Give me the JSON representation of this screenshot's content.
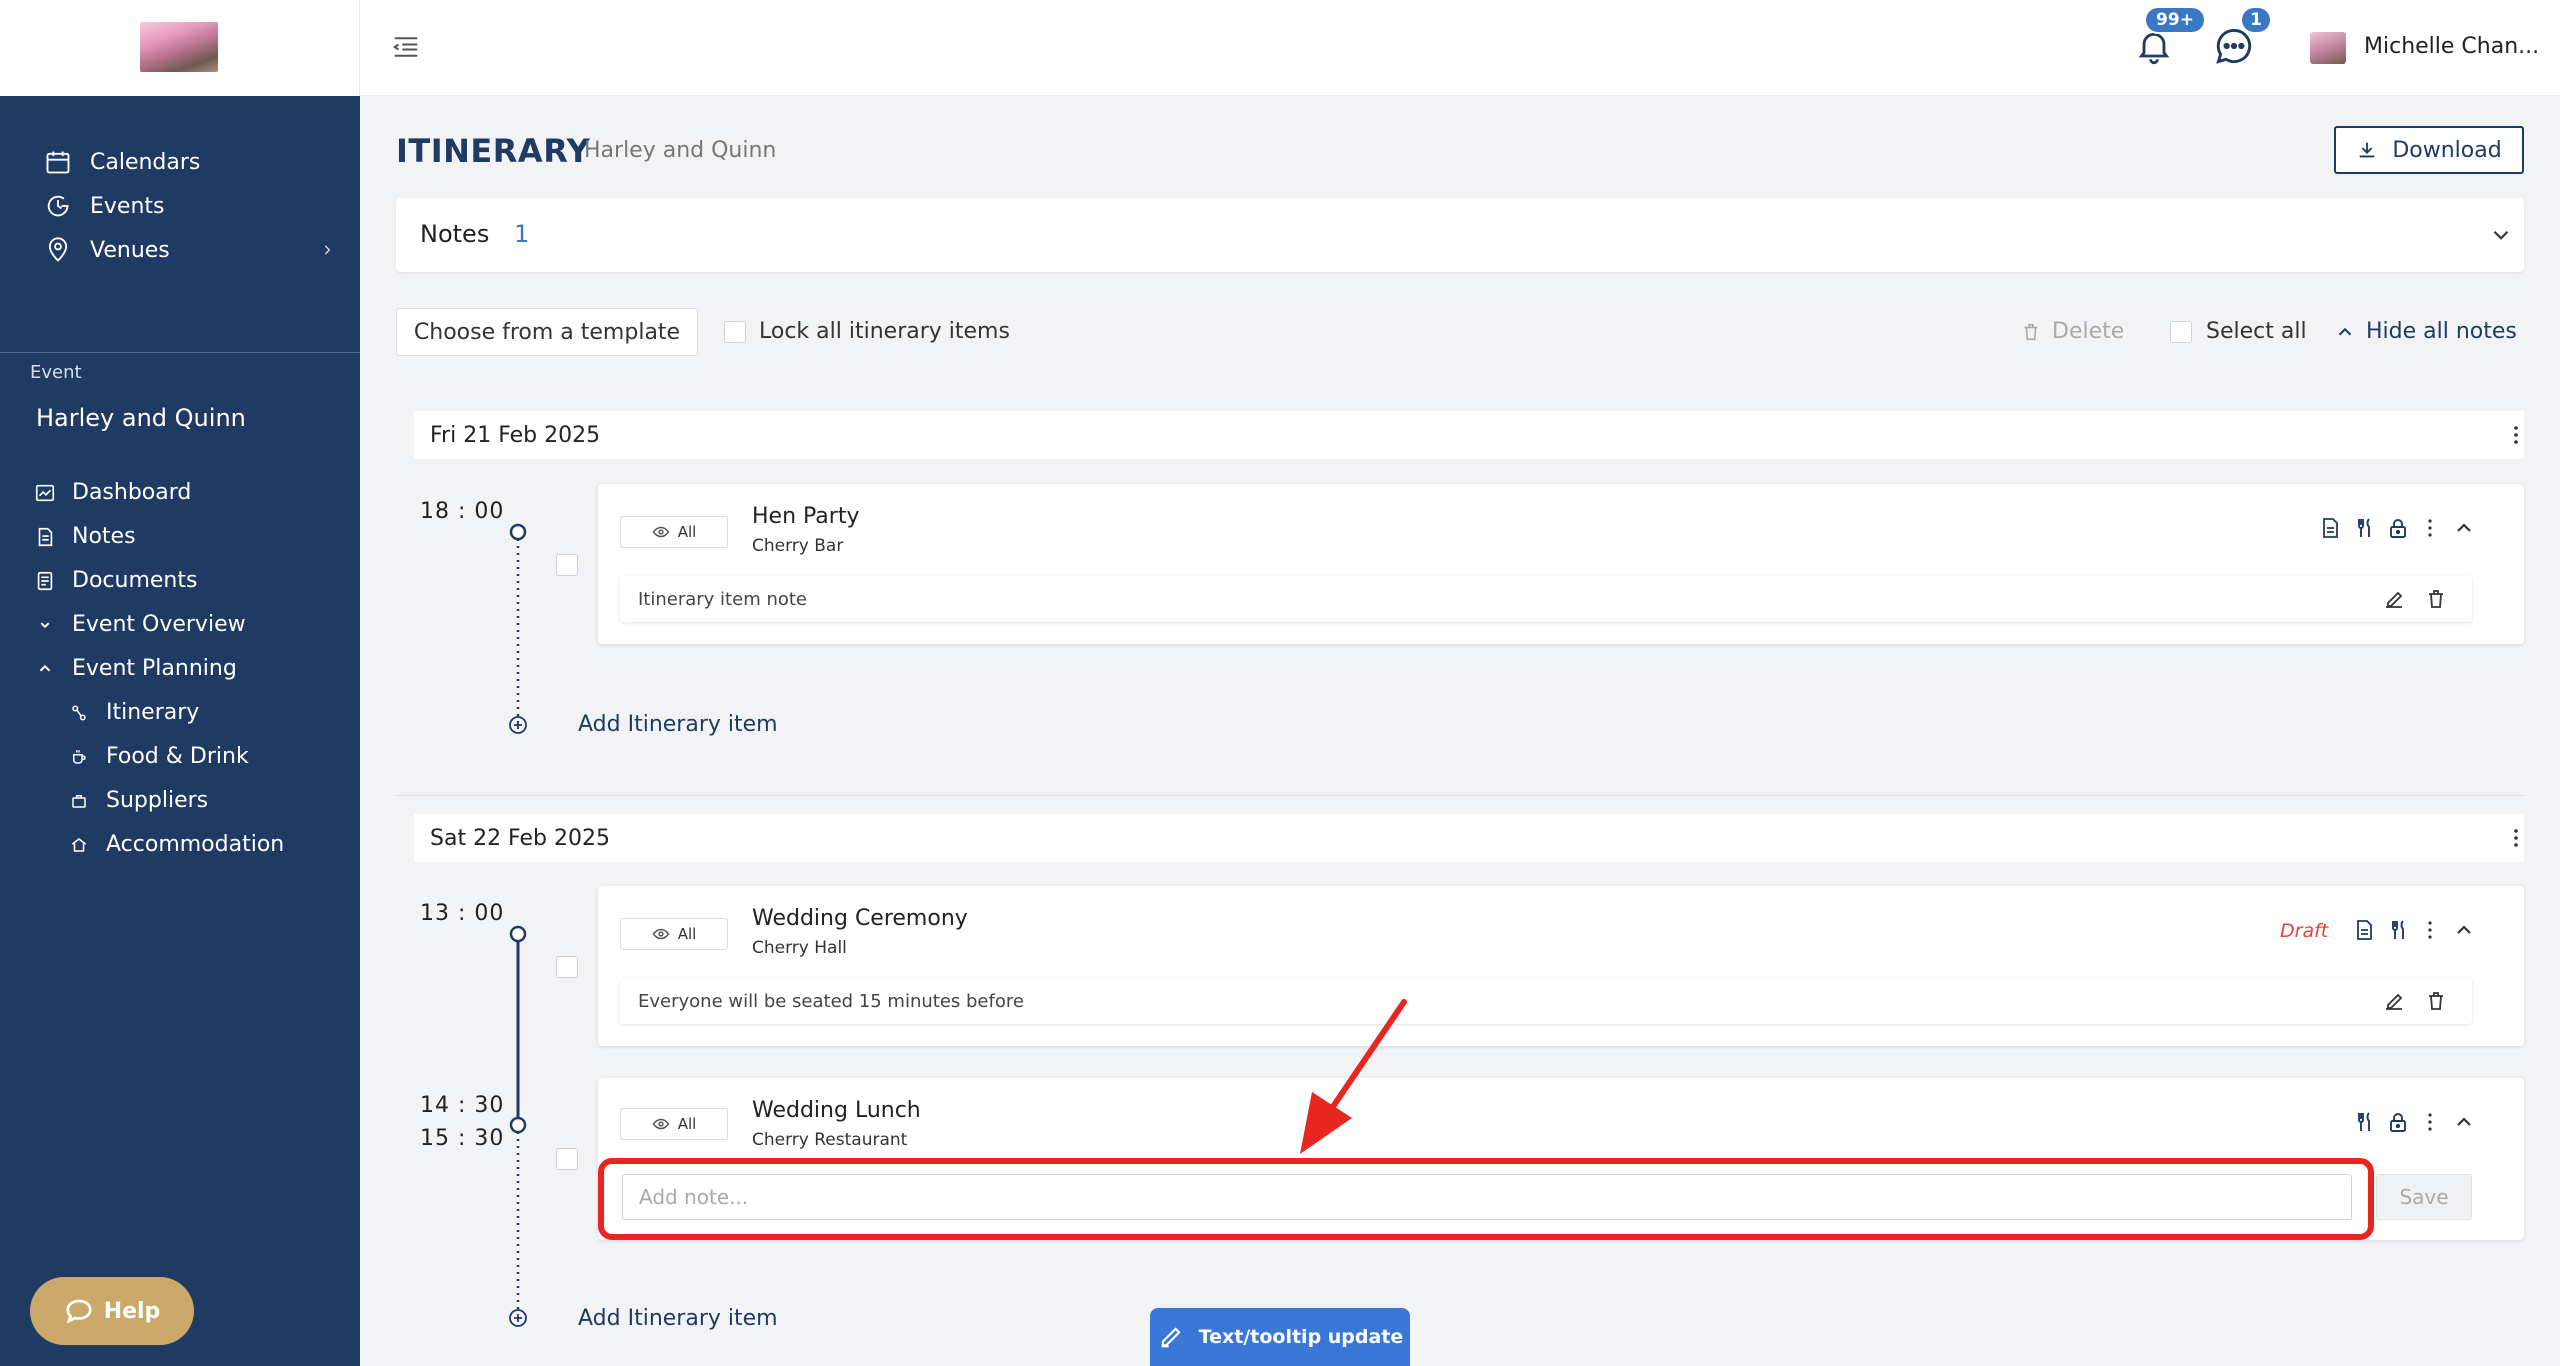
{
  "header": {
    "notifications_count": "99+",
    "messages_count": "1",
    "user_name": "Michelle Chan..."
  },
  "sidebar": {
    "top_items": [
      {
        "label": "Calendars",
        "icon": "calendar-icon"
      },
      {
        "label": "Events",
        "icon": "events-clock-icon"
      },
      {
        "label": "Venues",
        "icon": "location-pin-icon"
      }
    ],
    "event_caption": "Event",
    "event_name": "Harley and Quinn",
    "event_items": [
      {
        "label": "Dashboard",
        "icon": "dashboard-icon"
      },
      {
        "label": "Notes",
        "icon": "notes-icon"
      },
      {
        "label": "Documents",
        "icon": "documents-icon"
      },
      {
        "label": "Event Overview",
        "icon": "chevron-down-icon"
      },
      {
        "label": "Event Planning",
        "icon": "chevron-up-icon"
      }
    ],
    "planning_items": [
      {
        "label": "Itinerary",
        "icon": "itinerary-icon"
      },
      {
        "label": "Food & Drink",
        "icon": "food-drink-icon"
      },
      {
        "label": "Suppliers",
        "icon": "suppliers-icon"
      },
      {
        "label": "Accommodation",
        "icon": "accommodation-icon"
      }
    ],
    "help_label": "Help"
  },
  "page": {
    "title": "ITINERARY",
    "subtitle": "Harley and Quinn",
    "download_label": "Download"
  },
  "notes_panel": {
    "label": "Notes",
    "count": "1"
  },
  "toolbar": {
    "template_label": "Choose from a template",
    "lock_label": "Lock all itinerary items",
    "delete_label": "Delete",
    "select_all_label": "Select all",
    "hide_notes_label": "Hide all notes"
  },
  "days": [
    {
      "date": "Fri 21 Feb 2025",
      "items": [
        {
          "start": "18 : 00",
          "end": "",
          "visibility": "All",
          "title": "Hen Party",
          "venue": "Cherry Bar",
          "status": "",
          "note": "Itinerary item note"
        }
      ],
      "add_label": "Add Itinerary item"
    },
    {
      "date": "Sat 22 Feb 2025",
      "items": [
        {
          "start": "13 : 00",
          "end": "",
          "visibility": "All",
          "title": "Wedding Ceremony",
          "venue": "Cherry Hall",
          "status": "Draft",
          "note": "Everyone will be seated 15 minutes before"
        },
        {
          "start": "14 : 30",
          "end": "15 : 30",
          "visibility": "All",
          "title": "Wedding Lunch",
          "venue": "Cherry Restaurant",
          "status": "",
          "note": ""
        }
      ],
      "add_label": "Add Itinerary item"
    }
  ],
  "add_note": {
    "placeholder": "Add note...",
    "save_label": "Save"
  },
  "tooltip_button": {
    "label": "Text/tooltip update"
  },
  "colors": {
    "sidebar_bg": "#1f3b63",
    "accent_blue": "#3a78c4",
    "highlight_red": "#e8261f",
    "draft_red": "#e0463b",
    "help_gold": "#c9a86a"
  }
}
